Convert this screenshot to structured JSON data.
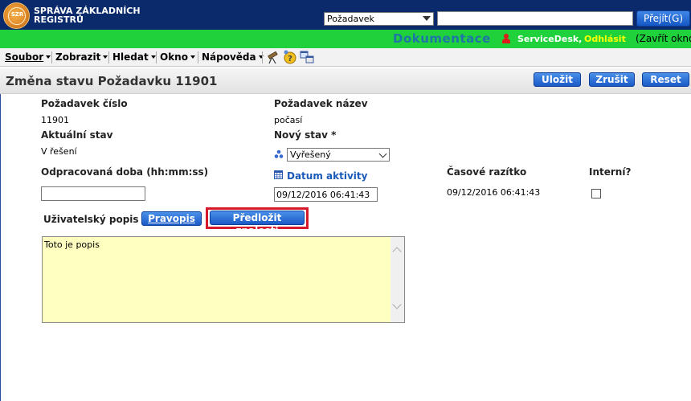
{
  "header": {
    "org_name_line1": "SPRÁVA ZÁKLADNÍCH",
    "org_name_line2": "REGISTRŮ",
    "logo_text": "SZR",
    "search_type_selected": "Požadavek",
    "search_value": "",
    "go_button_label": "Přejít(G)"
  },
  "greenbar": {
    "documentation": "Dokumentace",
    "user": "ServiceDesk,",
    "logout": "Odhlásit",
    "close_window": "(Zavřít okno"
  },
  "menu": {
    "file": "Soubor",
    "view": "Zobrazit",
    "find": "Hledat",
    "window": "Okno",
    "help": "Nápověda"
  },
  "title": {
    "text": "Změna stavu Požadavku 11901",
    "save_label": "Uložit",
    "cancel_label": "Zrušit",
    "reset_label": "Reset"
  },
  "form": {
    "request_number_label": "Požadavek číslo",
    "request_number_value": "11901",
    "request_name_label": "Požadavek název",
    "request_name_value": "počasí",
    "current_state_label": "Aktuální stav",
    "current_state_value": "V řešení",
    "new_state_label": "Nový stav *",
    "new_state_selected": "Vyřešený",
    "worked_time_label": "Odpracovaná doba (hh:mm:ss)",
    "worked_time_value": "",
    "activity_date_label": "Datum aktivity",
    "activity_date_value": "09/12/2016 06:41:43",
    "timestamp_label": "Časové razítko",
    "timestamp_value": "09/12/2016 06:41:43",
    "internal_label": "Interní?",
    "internal_checked": false,
    "user_description_label": "Uživatelský popis",
    "spellcheck_label": "Pravopis",
    "submit_knowledge_label": "Předložit znalosti",
    "description_text": "Toto je popis"
  },
  "colors": {
    "header_bg": "#0a2a6b",
    "green_bar": "#1fd23c",
    "button_blue": "#1a5ac8",
    "highlight_red": "#d6192a",
    "textarea_bg": "#ffffc0"
  }
}
